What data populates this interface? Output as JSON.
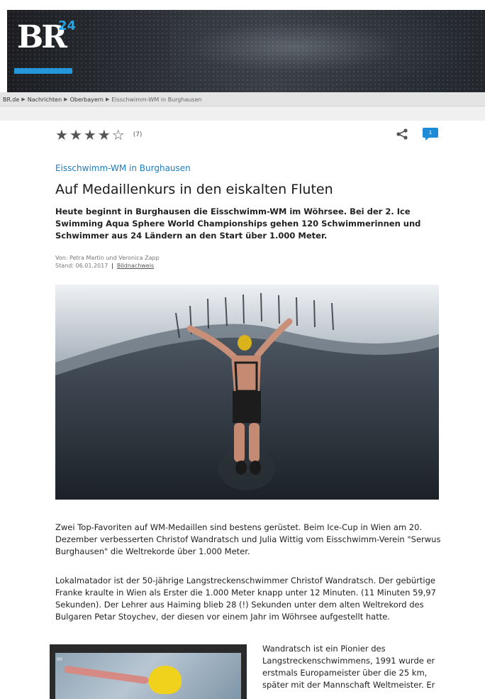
{
  "header": {
    "logo_text": "BR",
    "logo_num": "24",
    "accent_color": "#2596d9"
  },
  "breadcrumb": {
    "items": [
      "BR.de",
      "Nachrichten",
      "Oberbayern"
    ],
    "current": "Eisschwimm-WM in Burghausen"
  },
  "rating": {
    "stars_filled": 4,
    "stars_total": 5,
    "count": "(7)"
  },
  "actions": {
    "comment_count": "1"
  },
  "article": {
    "topline": "Eisschwimm-WM in Burghausen",
    "headline": "Auf Medaillenkurs in den eiskalten Fluten",
    "teaser": "Heute beginnt in Burghausen die Eisschwimm-WM im Wöhrsee. Bei der 2. Ice Swimming Aqua Sphere World Championships gehen 120 Schwimmerinnen und Schwimmer aus 24 Ländern an den Start über 1.000 Meter.",
    "byline_authors": "Von: Petra Martin und Veronica Zapp",
    "byline_date": "Stand: 06.01.2017",
    "byline_link": "Bildnachweis",
    "paragraph_1": "Zwei Top-Favoriten auf WM-Medaillen sind bestens gerüstet. Beim Ice-Cup in Wien am 20. Dezember verbesserten Christof Wandratsch und Julia Wittig vom Eisschwimm-Verein \"Serwus Burghausen\" die Weltrekorde über 1.000 Meter.",
    "paragraph_2": "Lokalmatador ist der 50-jährige Langstreckenschwimmer Christof Wandratsch. Der gebürtige Franke kraulte in Wien als Erster die 1.000 Meter knapp unter 12 Minuten. (11 Minuten 59,97 Sekunden). Der Lehrer aus Haiming blieb 28 (!) Sekunden unter dem alten Weltrekord des Bulgaren Petar Stoychev, der diesen vor einem Jahr im Wöhrsee aufgestellt hatte.",
    "paragraph_3": "Wandratsch ist ein Pionier des Langstreckenschwimmens, 1991 wurde er erstmals Europameister über die 25 km, später mit der Mannschaft Weltmeister. Er",
    "inline_image_label": "BR"
  },
  "colors": {
    "link_blue": "#1e7cc0",
    "comment_blue": "#1e8bd6"
  }
}
